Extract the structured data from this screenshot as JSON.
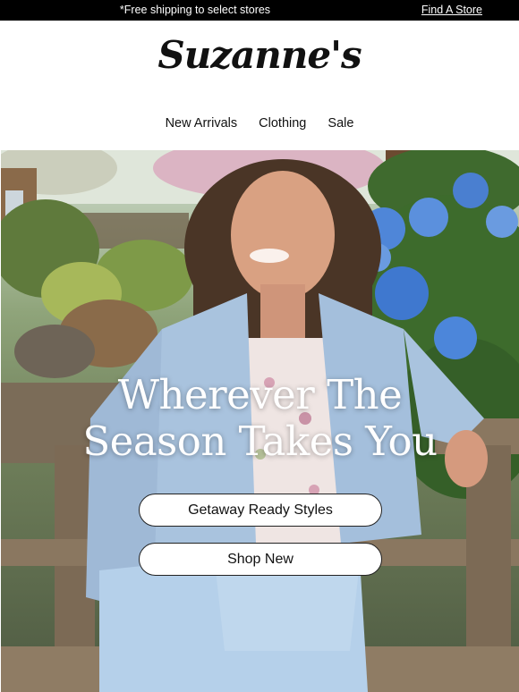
{
  "promo": {
    "text": "*Free shipping to select stores",
    "find_store": "Find A Store"
  },
  "header": {
    "logo": "Suzanne's",
    "nav": [
      "New Arrivals",
      "Clothing",
      "Sale"
    ]
  },
  "hero": {
    "headline_line1": "Wherever The",
    "headline_line2": "Season Takes You",
    "cta_primary": "Getaway Ready Styles",
    "cta_secondary": "Shop New"
  },
  "colors": {
    "promo_bg": "#000000",
    "cta_bg": "#ffffff",
    "denim": "#a9c3de",
    "hydrangea": "#4a7fd0"
  }
}
